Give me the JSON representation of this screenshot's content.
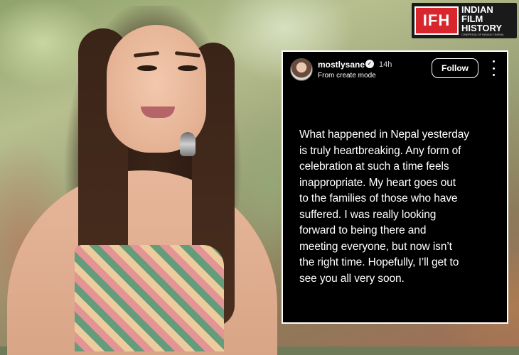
{
  "logo": {
    "mark": "IFH",
    "words": [
      "INDIAN",
      "FILM",
      "HISTORY"
    ],
    "tagline": "CINEPEDIA OF INDIAN CINEMA"
  },
  "post": {
    "username": "mostlysane",
    "verified": true,
    "time": "14h",
    "subtitle": "From create mode",
    "follow_label": "Follow",
    "more_icon": "three-dots-vertical-icon",
    "lines": [
      "What happened in Nepal yesterday",
      "is truly heartbreaking. Any form of",
      "celebration at such a time feels",
      "inappropriate. My heart goes out",
      "to the families of those who have",
      "suffered. I was really looking",
      "forward to being there and",
      "meeting everyone, but now isn’t",
      "the right time. Hopefully, I’ll get to",
      "see you all very soon."
    ]
  },
  "colors": {
    "logo_red": "#d8262c",
    "card_bg": "#000000",
    "text": "#ffffff"
  }
}
